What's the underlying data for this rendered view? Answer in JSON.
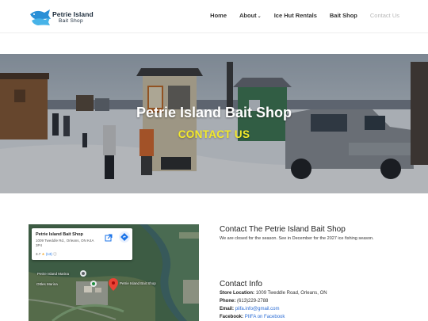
{
  "brand": {
    "line1": "Petrie Island",
    "line2": "Bait Shop"
  },
  "nav": [
    {
      "label": "Home"
    },
    {
      "label": "About"
    },
    {
      "label": "Ice Hut Rentals"
    },
    {
      "label": "Bait Shop"
    },
    {
      "label": "Contact Us"
    }
  ],
  "hero": {
    "title": "Petrie Island Bait Shop",
    "subtitle": "CONTACT US"
  },
  "map": {
    "place_name": "Petrie Island Bait Shop",
    "address": "1009 Tweddle Rd., Orleans, ON K4A 3P4",
    "rating": "3.7",
    "stars": "★",
    "review_count": "(13)",
    "labels": {
      "marina": "Petrie Island Marina",
      "pin": "Petrie Island Bait Shop",
      "outlet": "Ottles Marina"
    }
  },
  "contact": {
    "heading": "Contact The Petrie Island Bait Shop",
    "body": "We are closed for the season. See in December for the 2027 ice fishing season."
  },
  "info": {
    "heading": "Contact Info",
    "store_label": "Store Location:",
    "store_value": "1009 Tweddle Road, Orleans, ON",
    "phone_label": "Phone:",
    "phone_value": "(613)229-2788",
    "email_label": "Email:",
    "email_value": "piifa.info@gmail.com",
    "facebook_label": "Facebook:",
    "facebook_value": "PIIFA on Facebook"
  },
  "colors": {
    "accent_yellow": "#f3e92a",
    "link_blue": "#2b6cd4",
    "brand_blue": "#2a8fd6"
  }
}
